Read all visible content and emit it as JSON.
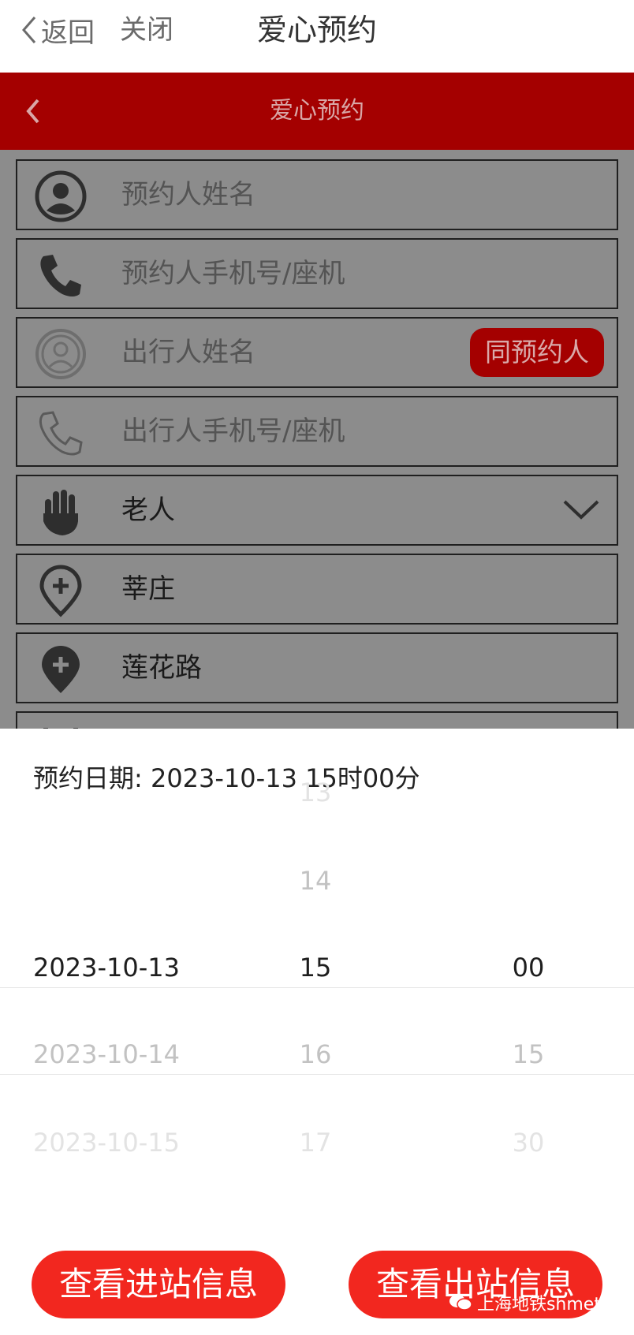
{
  "topbar": {
    "back_label": "返回",
    "close_label": "关闭",
    "title": "爱心预约"
  },
  "redbar": {
    "title": "爱心预约"
  },
  "form": {
    "booker_name_placeholder": "预约人姓名",
    "booker_phone_placeholder": "预约人手机号/座机",
    "traveler_name_placeholder": "出行人姓名",
    "same_as_booker_label": "同预约人",
    "traveler_phone_placeholder": "出行人手机号/座机",
    "traveler_type": "老人",
    "start_station": "莘庄",
    "end_station": "莲花路"
  },
  "picker": {
    "label": "预约日期: 2023-10-13 15时00分",
    "hour_above2": "13",
    "hour_above1": "14",
    "date_selected": "2023-10-13",
    "hour_selected": "15",
    "minute_selected": "00",
    "date_below1": "2023-10-14",
    "hour_below1": "16",
    "minute_below1": "15",
    "date_below2": "2023-10-15",
    "hour_below2": "17",
    "minute_below2": "30"
  },
  "buttons": {
    "entry_info": "查看进站信息",
    "exit_info": "查看出站信息"
  },
  "watermark": "上海地铁shmetro",
  "colors": {
    "header_red": "#a40000",
    "button_red": "#f2271f",
    "overlay_gray": "#8c8c8c"
  }
}
